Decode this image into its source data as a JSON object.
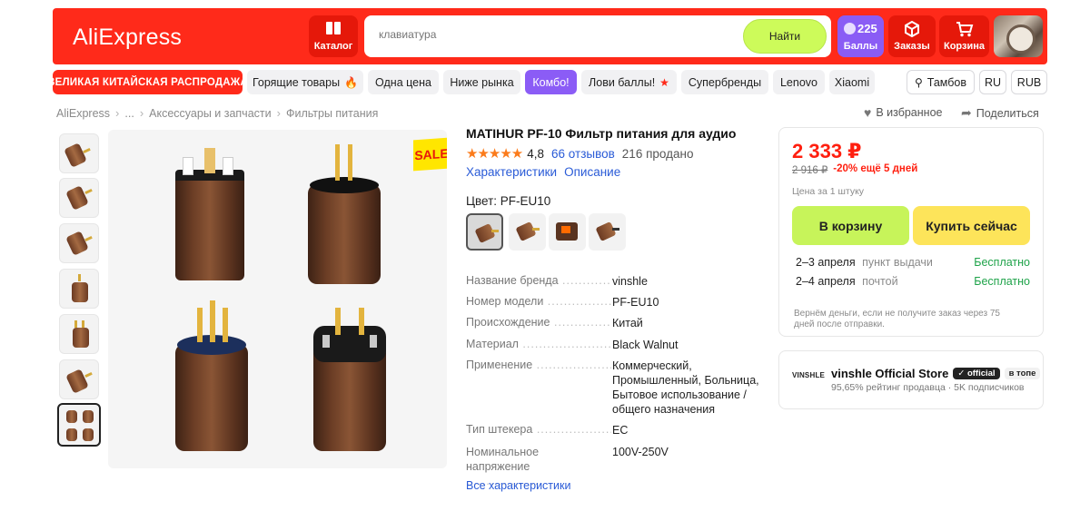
{
  "header": {
    "logo": "AliExpress",
    "catalog_label": "Каталог",
    "search_placeholder": "клавиатура",
    "search_button": "Найти",
    "points_value": "225",
    "points_label": "Баллы",
    "orders_label": "Заказы",
    "cart_label": "Корзина"
  },
  "chips": {
    "sale": "ВЕЛИКАЯ КИТАЙСКАЯ РАСПРОДАЖА",
    "hot": "Горящие товары",
    "one_price": "Одна цена",
    "below_market": "Ниже рынка",
    "combo": "Комбо!",
    "catch_points": "Лови баллы!",
    "superbrands": "Супербренды",
    "lenovo": "Lenovo",
    "xiaomi": "Xiaomi",
    "city": "Тамбов",
    "lang": "RU",
    "currency": "RUB"
  },
  "breadcrumb": [
    "AliExpress",
    "...",
    "Аксессуары и запчасти",
    "Фильтры питания"
  ],
  "actions": {
    "favorite": "В избранное",
    "share": "Поделиться"
  },
  "gallery": {
    "sale_badge": "SALE"
  },
  "product": {
    "title": "MATIHUR PF-10 Фильтр питания для аудио",
    "stars": "★★★★★",
    "rating": "4,8",
    "reviews": "66 отзывов",
    "sold": "216 продано",
    "link_specs": "Характеристики",
    "link_desc": "Описание",
    "color_label": "Цвет: PF-EU10",
    "specs": [
      {
        "k": "Название бренда",
        "v": "vinshle"
      },
      {
        "k": "Номер модели",
        "v": "PF-EU10"
      },
      {
        "k": "Происхождение",
        "v": "Китай"
      },
      {
        "k": "Материал",
        "v": "Black Walnut"
      },
      {
        "k": "Применение",
        "v": "Коммерческий, Промышленный, Больница, Бытовое использование / общего назначения"
      },
      {
        "k": "Тип штекера",
        "v": "EC"
      },
      {
        "k": "Номинальное напряжение",
        "v": "100V-250V"
      }
    ],
    "all_specs": "Все характеристики"
  },
  "buy": {
    "price": "2 333 ₽",
    "old_price": "2 916 ₽",
    "discount": "-20% ещё 5 дней",
    "unit": "Цена за 1 штуку",
    "cart_btn": "В корзину",
    "buy_btn": "Купить сейчас",
    "delivery": [
      {
        "date": "2–3 апреля",
        "method": "пункт выдачи",
        "price": "Бесплатно"
      },
      {
        "date": "2–4 апреля",
        "method": "почтой",
        "price": "Бесплатно"
      }
    ],
    "guarantee": "Вернём деньги, если не получите заказ через 75 дней после отправки."
  },
  "store": {
    "logo_text": "VINSHLE",
    "name": "vinshle Official Store",
    "official": "official",
    "top": "в топе",
    "rating_text": "95,65% рейтинг продавца",
    "subs": "5K подписчиков"
  }
}
